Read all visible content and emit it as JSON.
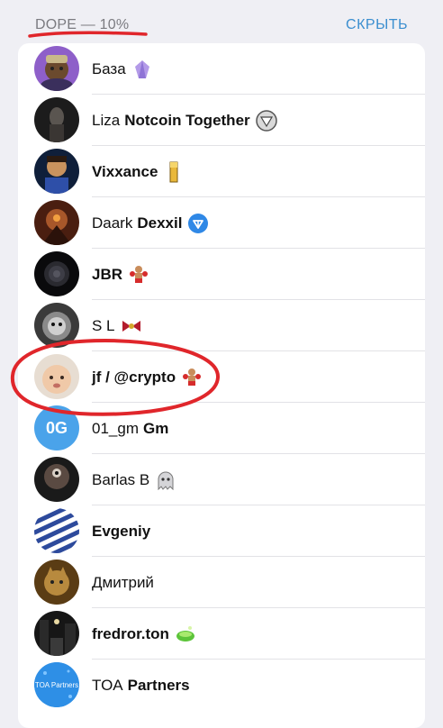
{
  "section": {
    "title": "DOPE — 10%",
    "hide_label": "СКРЫТЬ"
  },
  "colors": {
    "accent": "#3a8ecf",
    "annotation_red": "#e0262b",
    "verified_blue": "#2f88e6"
  },
  "members": [
    {
      "first": "База",
      "last": "",
      "emoji": "crystal-icon",
      "avatar": "purple-character"
    },
    {
      "first": "Liza",
      "last": "Notcoin Together",
      "emoji": "notcoin-icon",
      "avatar": "dark-portrait"
    },
    {
      "first": "Vixxance",
      "last": "",
      "emoji": "gold-bar-icon",
      "avatar": "caricature"
    },
    {
      "first": "Daark",
      "last": "Dexxil",
      "emoji": "ton-verified-icon",
      "avatar": "fire-figure"
    },
    {
      "first": "JBR",
      "last": "",
      "emoji": "boxer-icon",
      "avatar": "black-rose"
    },
    {
      "first": "S L",
      "last": "",
      "emoji": "bow-icon",
      "avatar": "lion-bw"
    },
    {
      "first": "jf / @crypto",
      "last": "",
      "emoji": "boxer-icon",
      "avatar": "baby-photo"
    },
    {
      "first": "01_gm",
      "last": "Gm",
      "emoji": "",
      "avatar_text": "0G"
    },
    {
      "first": "Barlas B",
      "last": "",
      "emoji": "ghost-icon",
      "avatar": "dark-creature"
    },
    {
      "first": "Evgeniy",
      "last": "",
      "emoji": "",
      "avatar": "blue-stripes"
    },
    {
      "first": "Дмитрий",
      "last": "",
      "emoji": "",
      "avatar": "golden-cat"
    },
    {
      "first": "fredror.ton",
      "last": "",
      "emoji": "green-bowl-icon",
      "avatar": "night-street"
    },
    {
      "first": "TOA",
      "last": "Partners",
      "emoji": "",
      "avatar_text": "TOA Partners"
    }
  ]
}
